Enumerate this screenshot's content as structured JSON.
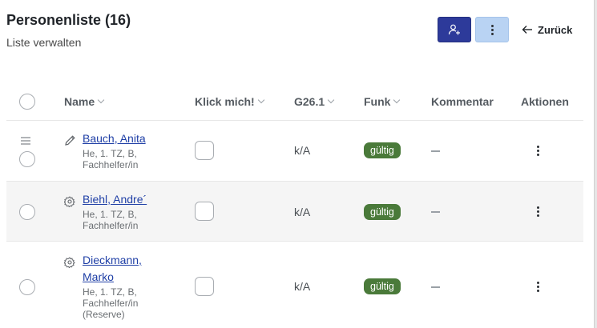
{
  "header": {
    "title": "Personenliste (16)",
    "subtitle": "Liste verwalten",
    "add_person_icon": "add-person-icon",
    "more_icon": "vertical-dots-icon",
    "back_label": "Zurück",
    "back_icon": "arrow-left-icon"
  },
  "columns": {
    "name": "Name",
    "klick": "Klick mich!",
    "g26": "G26.1",
    "funk": "Funk",
    "kommentar": "Kommentar",
    "aktionen": "Aktionen"
  },
  "rows": [
    {
      "name": "Bauch, Anita",
      "meta": [
        "He, 1. TZ, B,",
        "Fachhelfer/in"
      ],
      "g26": "k/A",
      "funk": "gültig",
      "kommentar": "",
      "icon": "pencil-icon"
    },
    {
      "name": "Biehl, Andre´",
      "meta": [
        "He, 1. TZ, B,",
        "Fachhelfer/in"
      ],
      "g26": "k/A",
      "funk": "gültig",
      "kommentar": "",
      "icon": "gear-icon"
    },
    {
      "name_lines": [
        "Dieckmann,",
        "Marko"
      ],
      "meta": [
        "He, 1. TZ, B,",
        "Fachhelfer/in",
        "(Reserve)"
      ],
      "g26": "k/A",
      "funk": "gültig",
      "kommentar": "",
      "icon": "gear-icon"
    }
  ],
  "colors": {
    "primary": "#2d3a9a",
    "secondary": "#b9d3f3",
    "badge_green": "#4a7a3a",
    "link": "#1f3fa6"
  }
}
